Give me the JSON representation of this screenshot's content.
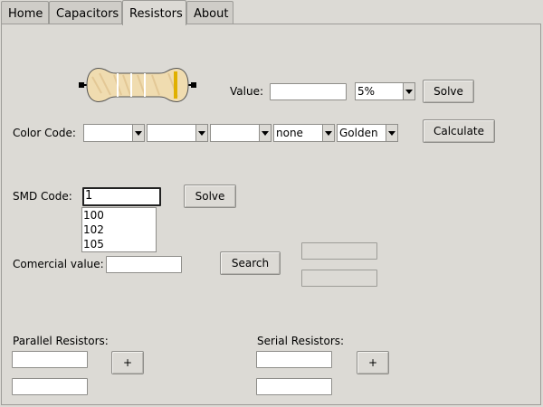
{
  "tabs": [
    {
      "label": "Home",
      "active": false
    },
    {
      "label": "Capacitors",
      "active": false
    },
    {
      "label": "Resistors",
      "active": true
    },
    {
      "label": "About",
      "active": false
    }
  ],
  "value_section": {
    "label": "Value:",
    "input_value": "",
    "tolerance": "5%",
    "solve_label": "Solve"
  },
  "color_code": {
    "label": "Color Code:",
    "bands": [
      "",
      "",
      "",
      "none",
      "Golden"
    ],
    "calculate_label": "Calculate"
  },
  "smd": {
    "label": "SMD Code:",
    "input_value": "1",
    "solve_label": "Solve",
    "suggestions": [
      "100",
      "102",
      "105"
    ]
  },
  "commercial": {
    "label": "Comercial value:",
    "input_value": "",
    "search_label": "Search"
  },
  "parallel": {
    "label": "Parallel Resistors:",
    "add_label": "+"
  },
  "serial": {
    "label": "Serial Resistors:",
    "add_label": "+"
  },
  "colors": {
    "background": "#dcdad5",
    "resistor_body": "#f0dcb0",
    "tolerance_band": "#e0b000"
  },
  "icons": {
    "resistor": "resistor-image"
  }
}
